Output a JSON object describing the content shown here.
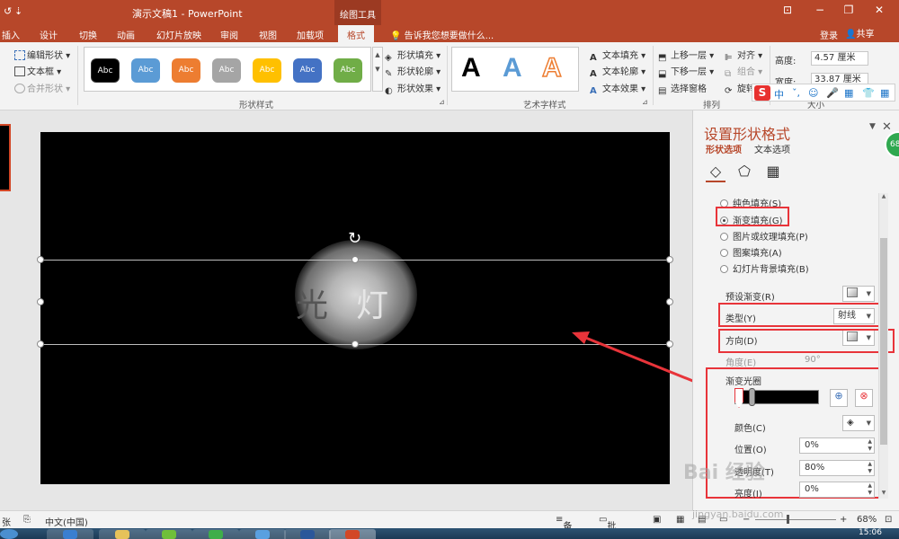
{
  "titlebar": {
    "app_title": "演示文稿1 - PowerPoint",
    "context_tab": "绘图工具",
    "qa_redo": "↺",
    "qa_customize": "⇣",
    "minimize": "−",
    "restore": "❐",
    "close": "✕",
    "ribbon_display": "⊡"
  },
  "tabs": {
    "items": [
      "插入",
      "设计",
      "切换",
      "动画",
      "幻灯片放映",
      "审阅",
      "视图",
      "加载项",
      "格式"
    ],
    "active": "格式",
    "tell_me": "告诉我您想要做什么...",
    "sign_in": "登录",
    "share": "共享"
  },
  "ribbon": {
    "insert_shapes": {
      "edit_shape": "编辑形状",
      "text_box": "文本框",
      "merge_shapes": "合并形状"
    },
    "shape_styles": {
      "label": "形状样式",
      "buttons": [
        {
          "text": "Abc",
          "color": "#000000"
        },
        {
          "text": "Abc",
          "color": "#5b9bd5"
        },
        {
          "text": "Abc",
          "color": "#ed7d31"
        },
        {
          "text": "Abc",
          "color": "#a5a5a5"
        },
        {
          "text": "Abc",
          "color": "#ffc000"
        },
        {
          "text": "Abc",
          "color": "#4472c4"
        },
        {
          "text": "Abc",
          "color": "#70ad47"
        }
      ],
      "fill": "形状填充",
      "outline": "形状轮廓",
      "effects": "形状效果"
    },
    "wordart": {
      "label": "艺术字样式",
      "sample": "A",
      "text_fill": "文本填充",
      "text_outline": "文本轮廓",
      "text_effects": "文本效果"
    },
    "arrange": {
      "label": "排列",
      "bring_forward": "上移一层",
      "send_backward": "下移一层",
      "selection_pane": "选择窗格",
      "align": "对齐",
      "group": "组合",
      "rotate": "旋转"
    },
    "size": {
      "label": "大小",
      "height_label": "高度:",
      "height_value": "4.57 厘米",
      "width_label": "宽度:",
      "width_value": "33.87 厘米"
    }
  },
  "ime": {
    "logo": "S",
    "mode": "中",
    "punct": "ˇ,",
    "emoji": "☺",
    "voice": "🎤",
    "keyboard": "▦",
    "skin": "👕",
    "tools": "▦"
  },
  "slide": {
    "text_left": "光",
    "text_right": "灯",
    "rotate_handle": "↻"
  },
  "pane": {
    "title": "设置形状格式",
    "tab_shape": "形状选项",
    "tab_text": "文本选项",
    "fill_icon": "◇",
    "effects_icon": "⬠",
    "size_icon": "▦",
    "dropdown": "▼",
    "close": "✕",
    "fill_options": [
      {
        "label": "纯色填充(S)",
        "selected": false
      },
      {
        "label": "渐变填充(G)",
        "selected": true
      },
      {
        "label": "图片或纹理填充(P)",
        "selected": false
      },
      {
        "label": "图案填充(A)",
        "selected": false
      },
      {
        "label": "幻灯片背景填充(B)",
        "selected": false
      }
    ],
    "preset_label": "预设渐变(R)",
    "type_label": "类型(Y)",
    "type_value": "射线",
    "direction_label": "方向(D)",
    "angle_label": "角度(E)",
    "angle_value": "90°",
    "stops_label": "渐变光圈",
    "color_label": "颜色(C)",
    "position_label": "位置(O)",
    "position_value": "0%",
    "transparency_label": "透明度(T)",
    "transparency_value": "80%",
    "brightness_label": "亮度(I)",
    "brightness_value": "0%",
    "add_stop_icon": "⊕",
    "remove_stop_icon": "⊗"
  },
  "statusbar": {
    "slide_info": "张",
    "language": "中文(中国)",
    "notes": "备注",
    "comments": "批注",
    "zoom_minus": "−",
    "zoom_plus": "+",
    "zoom": "68%"
  },
  "taskbar": {
    "clock": "15:06"
  },
  "watermark": {
    "brand": "Bai 经验",
    "url": "jingyan.baidu.com"
  },
  "badge": "68"
}
